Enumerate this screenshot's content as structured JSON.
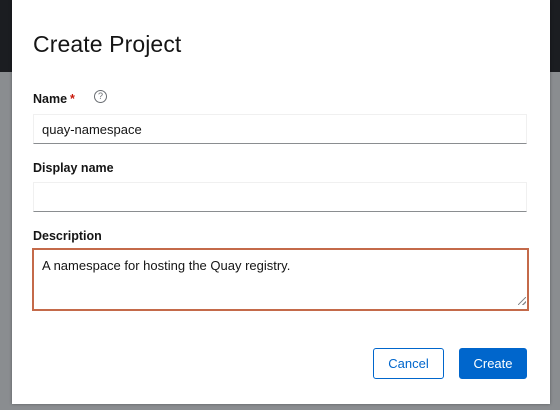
{
  "dialog": {
    "title": "Create Project"
  },
  "fields": {
    "name": {
      "label": "Name",
      "required_mark": "*",
      "help_glyph": "?",
      "value": "quay-namespace"
    },
    "display_name": {
      "label": "Display name",
      "value": ""
    },
    "description": {
      "label": "Description",
      "value": "A namespace for hosting the Quay registry."
    }
  },
  "actions": {
    "cancel_label": "Cancel",
    "create_label": "Create"
  },
  "colors": {
    "primary": "#0066cc",
    "required": "#c9190b",
    "focus_border": "#c46a4a"
  },
  "icons": {
    "help": "question-circle-icon",
    "resize": "resize-grip-icon"
  }
}
